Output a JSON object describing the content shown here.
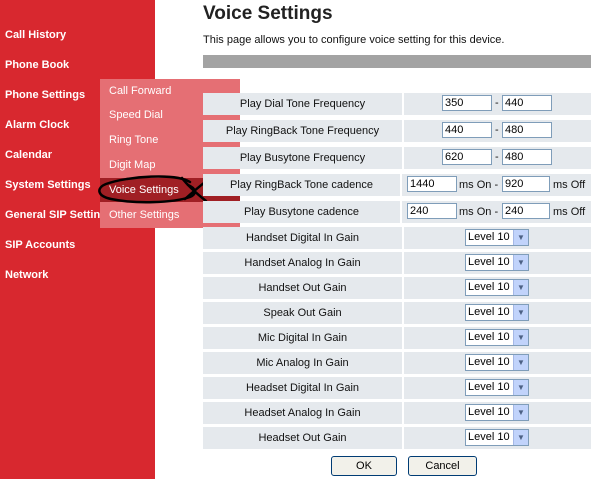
{
  "sidebar": {
    "items": [
      {
        "label": "Call History"
      },
      {
        "label": "Phone Book"
      },
      {
        "label": "Phone Settings"
      },
      {
        "label": "Alarm Clock"
      },
      {
        "label": "Calendar"
      },
      {
        "label": "System Settings"
      },
      {
        "label": "General SIP Settin"
      },
      {
        "label": "SIP Accounts"
      },
      {
        "label": "Network"
      }
    ]
  },
  "submenu": {
    "items": [
      {
        "label": "Call Forward"
      },
      {
        "label": "Speed Dial"
      },
      {
        "label": "Ring Tone"
      },
      {
        "label": "Digit Map"
      },
      {
        "label": "Voice Settings",
        "active": true
      },
      {
        "label": "Other Settings"
      }
    ]
  },
  "main": {
    "title": "Voice Settings",
    "description": "This page allows you to configure voice setting for this device."
  },
  "settings": {
    "freq_rows": [
      {
        "label": "Play Dial Tone Frequency",
        "value1": "350",
        "value2": "440"
      },
      {
        "label": "Play RingBack Tone Frequency",
        "value1": "440",
        "value2": "480"
      },
      {
        "label": "Play Busytone Frequency",
        "value1": "620",
        "value2": "480"
      }
    ],
    "dash": "-",
    "cadence_rows": [
      {
        "label": "Play RingBack Tone cadence",
        "on_value": "1440",
        "off_value": "920"
      },
      {
        "label": "Play Busytone cadence",
        "on_value": "240",
        "off_value": "240"
      }
    ],
    "ms_on_label": "ms On -",
    "ms_off_label": "ms Off",
    "gain_rows": [
      {
        "label": "Handset Digital In Gain",
        "value": "Level 10"
      },
      {
        "label": "Handset Analog In Gain",
        "value": "Level 10"
      },
      {
        "label": "Handset Out Gain",
        "value": "Level 10"
      },
      {
        "label": "Speak Out Gain",
        "value": "Level 10"
      },
      {
        "label": "Mic Digital In Gain",
        "value": "Level 10"
      },
      {
        "label": "Mic Analog In Gain",
        "value": "Level 10"
      },
      {
        "label": "Headset Digital In Gain",
        "value": "Level 10"
      },
      {
        "label": "Headset Analog In Gain",
        "value": "Level 10"
      },
      {
        "label": "Headset Out Gain",
        "value": "Level 10"
      }
    ]
  },
  "buttons": {
    "ok": "OK",
    "cancel": "Cancel"
  },
  "colors": {
    "sidebar": "#d8282f",
    "submenu": "#e56f74",
    "submenu_active": "#a01f24",
    "row_bg": "#e5e9ed"
  },
  "icons": {
    "select_arrow": "chevron-down-icon",
    "annotation": "hand-drawn-circle-annotation"
  }
}
